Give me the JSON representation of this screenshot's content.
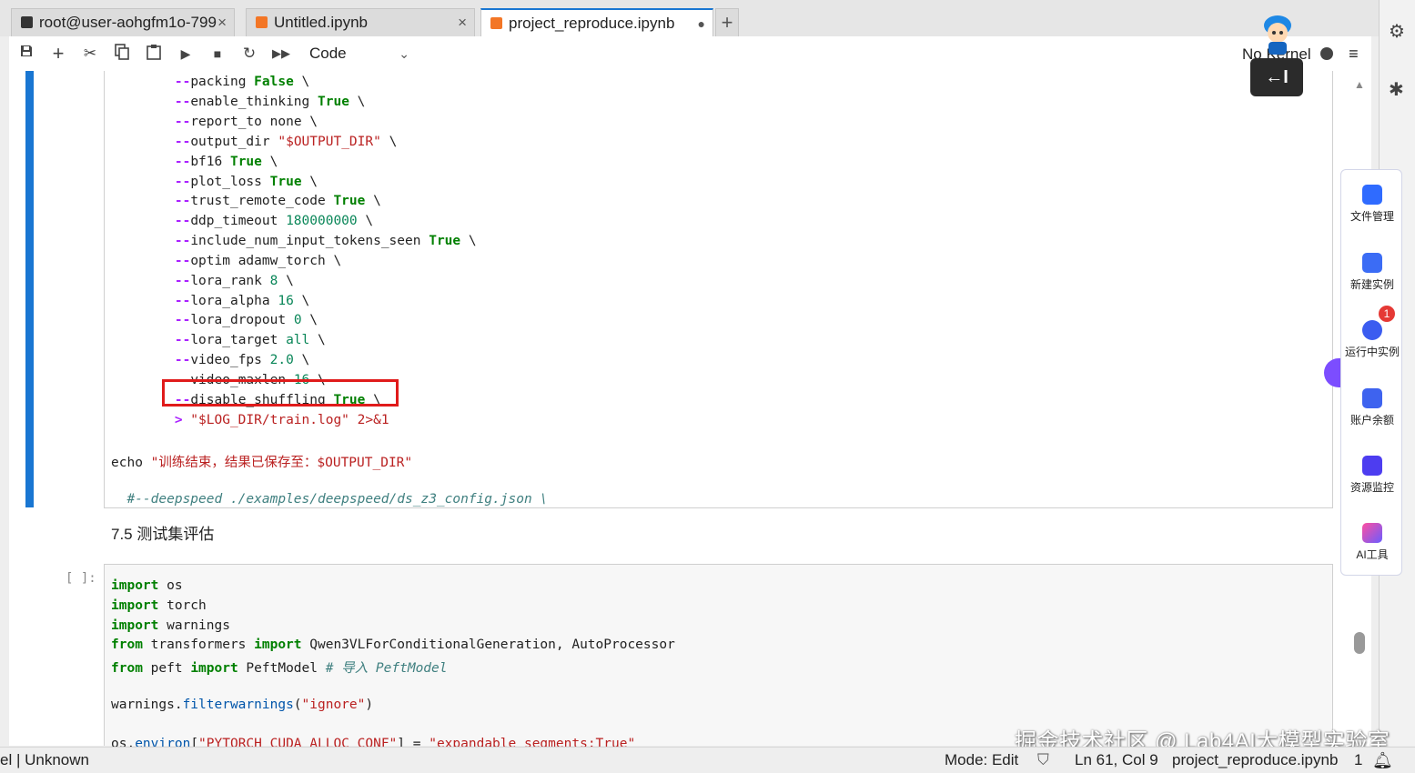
{
  "tabs": [
    {
      "label": "root@user-aohgfm1o-799",
      "close": "×",
      "icon": "terminal-icon"
    },
    {
      "label": "Untitled.ipynb",
      "close": "×",
      "icon": "notebook-icon"
    },
    {
      "label": "project_reproduce.ipynb",
      "close": "●",
      "icon": "notebook-icon"
    }
  ],
  "new_tab_label": "+",
  "toolbar": {
    "cell_type": "Code",
    "kernel_label": "No Kernel",
    "buttons": [
      "save-icon",
      "add-cell-icon",
      "cut-icon",
      "copy-icon",
      "paste-icon",
      "run-icon",
      "stop-icon",
      "restart-icon",
      "fast-forward-icon"
    ]
  },
  "tooltip_text": "←I",
  "cell1_lines": [
    {
      "flag": "--packing",
      "value": "False",
      "vclass": "kw",
      "tail": " \\"
    },
    {
      "flag": "--enable_thinking",
      "value": "True",
      "vclass": "kw",
      "tail": " \\"
    },
    {
      "flag": "--report_to",
      "value": "none",
      "vclass": "",
      "tail": " \\"
    },
    {
      "flag": "--output_dir",
      "value": "\"$OUTPUT_DIR\"",
      "vclass": "str",
      "tail": " \\"
    },
    {
      "flag": "--bf16",
      "value": "True",
      "vclass": "kw",
      "tail": " \\"
    },
    {
      "flag": "--plot_loss",
      "value": "True",
      "vclass": "kw",
      "tail": " \\"
    },
    {
      "flag": "--trust_remote_code",
      "value": "True",
      "vclass": "kw",
      "tail": " \\"
    },
    {
      "flag": "--ddp_timeout",
      "value": "180000000",
      "vclass": "num",
      "tail": " \\"
    },
    {
      "flag": "--include_num_input_tokens_seen",
      "value": "True",
      "vclass": "kw",
      "tail": " \\"
    },
    {
      "flag": "--optim",
      "value": "adamw_torch",
      "vclass": "",
      "tail": " \\"
    },
    {
      "flag": "--lora_rank",
      "value": "8",
      "vclass": "num",
      "tail": " \\"
    },
    {
      "flag": "--lora_alpha",
      "value": "16",
      "vclass": "num",
      "tail": " \\"
    },
    {
      "flag": "--lora_dropout",
      "value": "0",
      "vclass": "num",
      "tail": " \\"
    },
    {
      "flag": "--lora_target",
      "value": "all",
      "vclass": "num",
      "tail": " \\"
    },
    {
      "flag": "--video_fps",
      "value": "2.0",
      "vclass": "num",
      "tail": " \\"
    },
    {
      "flag": "--video_maxlen",
      "value": "16",
      "vclass": "num",
      "tail": " \\"
    },
    {
      "flag": "--disable_shuffling",
      "value": "True",
      "vclass": "kw",
      "tail": " \\"
    }
  ],
  "redirect_line": {
    "op": ">",
    "path": " \"$LOG_DIR/train.log\"",
    "tail": " 2>&1"
  },
  "echo_line": {
    "cmd": "echo",
    "text": " \"训练结束，结果已保存至：$OUTPUT_DIR\""
  },
  "comment_line": "#--deepspeed ./examples/deepspeed/ds_z3_config.json \\",
  "markdown_heading": "7.5 测试集评估",
  "cell2_prompt": "[ ]:",
  "cell2_lines": [
    {
      "k1": "import",
      "rest": " os"
    },
    {
      "k1": "import",
      "rest": " torch"
    },
    {
      "k1": "import",
      "rest": " warnings"
    },
    {
      "k1": "from",
      "mid": " transformers ",
      "k2": "import",
      "rest": " Qwen3VLForConditionalGeneration, AutoProcessor"
    },
    {
      "k1": "from",
      "mid": " peft ",
      "k2": "import",
      "rest": " PeftModel ",
      "comment": "# 导入 PeftModel"
    }
  ],
  "cell2_warnings": {
    "obj": "warnings.",
    "fn": "filterwarnings",
    "open": "(",
    "arg": "\"ignore\"",
    "close": ")"
  },
  "cell2_environ": {
    "obj": "os.",
    "fn": "environ",
    "open": "[",
    "key": "\"PYTORCH_CUDA_ALLOC_CONF\"",
    "mid": "] = ",
    "val": "\"expandable_segments:True\""
  },
  "panel_items": [
    {
      "label": "文件管理",
      "icon": "folder-icon"
    },
    {
      "label": "新建实例",
      "icon": "new-instance-icon"
    },
    {
      "label": "运行中实例",
      "icon": "running-instance-icon"
    },
    {
      "label": "账户余额",
      "icon": "balance-icon"
    },
    {
      "label": "资源监控",
      "icon": "monitor-icon"
    },
    {
      "label": "AI工具",
      "icon": "ai-tools-icon"
    }
  ],
  "badge_count": "1",
  "status": {
    "left": "el | Unknown",
    "mode": "Mode: Edit",
    "position": "Ln 61, Col 9",
    "file": "project_reproduce.ipynb",
    "count": "1"
  },
  "watermark": "掘金技术社区 @ Lab4AI大模型实验室",
  "colors": {
    "accent": "#1976d2",
    "highlight": "#e01b1b",
    "panel_accent": "#7c4dff"
  }
}
